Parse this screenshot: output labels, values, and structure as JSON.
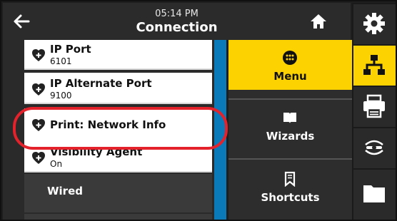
{
  "header": {
    "time": "05:14 PM",
    "title": "Connection",
    "back_icon": "back-arrow-icon",
    "home_icon": "home-icon"
  },
  "list": {
    "items": [
      {
        "label": "IP Port",
        "value": "6101"
      },
      {
        "label": "IP Alternate Port",
        "value": "9100"
      },
      {
        "label": "Print: Network Info",
        "value": ""
      },
      {
        "label": "Visibility Agent",
        "value": "On"
      }
    ],
    "section": "Wired"
  },
  "nav": {
    "menu": "Menu",
    "wizards": "Wizards",
    "shortcuts": "Shortcuts"
  },
  "rail": {
    "icons": [
      "gear-icon",
      "network-icon",
      "printer-icon",
      "wireless-icon",
      "folder-icon"
    ]
  },
  "colors": {
    "accent_yellow": "#fcd200",
    "highlight_red": "#e3222b",
    "scrollbar_blue": "#0a7ab8"
  }
}
